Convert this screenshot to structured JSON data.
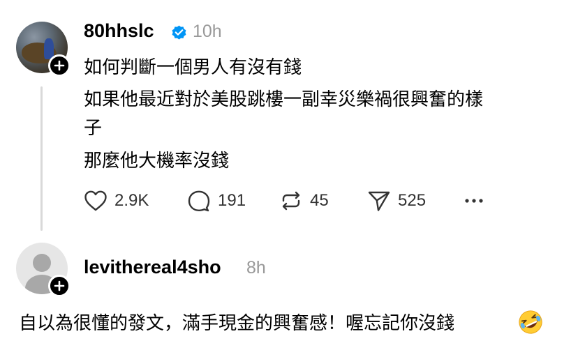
{
  "post": {
    "username": "80hhslc",
    "time": "10h",
    "lines": [
      "如何判斷一個男人有沒有錢",
      "如果他最近對於美股跳樓一副幸災樂禍很興奮的樣",
      "子",
      "那麼他大機率沒錢"
    ],
    "stats": {
      "likes": "2.9K",
      "replies": "191",
      "reposts": "45",
      "shares": "525"
    }
  },
  "reply": {
    "username": "levithereal4sho",
    "time": "8h",
    "text": "自以為很懂的發文，滿手現金的興奮感！喔忘記你沒錢"
  },
  "colors": {
    "verified": "#0095f6",
    "muted": "#999999",
    "thread_line": "#d9d9d9"
  }
}
